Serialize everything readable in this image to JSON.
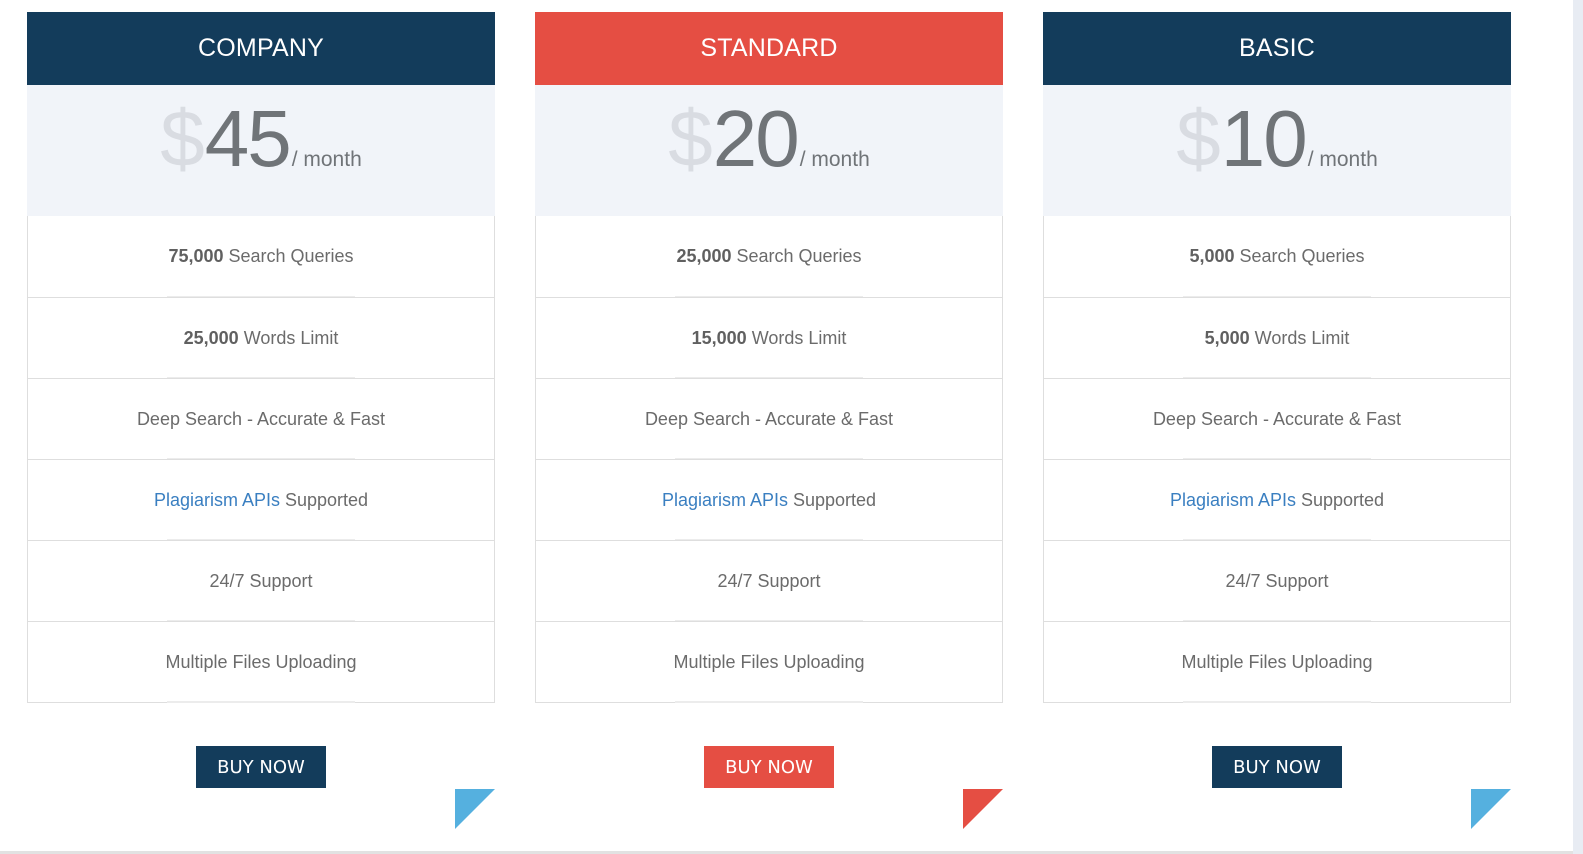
{
  "colors": {
    "navy": "#133c5b",
    "red": "#e54e43",
    "price_bg": "#f1f4f9",
    "link_blue": "#3a7fc1",
    "corner_blue": "#55b0df"
  },
  "plans": [
    {
      "name": "COMPANY",
      "currency": "$",
      "price": "45",
      "period": "/ month",
      "features": [
        {
          "bold": "75,000",
          "text": "Search Queries"
        },
        {
          "bold": "25,000",
          "text": "Words Limit"
        },
        {
          "text": "Deep Search - Accurate & Fast"
        },
        {
          "link": "Plagiarism APIs",
          "text": "Supported"
        },
        {
          "text": "24/7 Support"
        },
        {
          "text": "Multiple Files Uploading"
        }
      ],
      "button_label": "BUY NOW",
      "header_color": "navy",
      "corner_icon": "corner-triangle-blue"
    },
    {
      "name": "STANDARD",
      "currency": "$",
      "price": "20",
      "period": "/ month",
      "features": [
        {
          "bold": "25,000",
          "text": "Search Queries"
        },
        {
          "bold": "15,000",
          "text": "Words Limit"
        },
        {
          "text": "Deep Search - Accurate & Fast"
        },
        {
          "link": "Plagiarism APIs",
          "text": "Supported"
        },
        {
          "text": "24/7 Support"
        },
        {
          "text": "Multiple Files Uploading"
        }
      ],
      "button_label": "BUY NOW",
      "header_color": "red",
      "corner_icon": "corner-triangle-red"
    },
    {
      "name": "BASIC",
      "currency": "$",
      "price": "10",
      "period": "/ month",
      "features": [
        {
          "bold": "5,000",
          "text": "Search Queries"
        },
        {
          "bold": "5,000",
          "text": "Words Limit"
        },
        {
          "text": "Deep Search - Accurate & Fast"
        },
        {
          "link": "Plagiarism APIs",
          "text": "Supported"
        },
        {
          "text": "24/7 Support"
        },
        {
          "text": "Multiple Files Uploading"
        }
      ],
      "button_label": "BUY NOW",
      "header_color": "navy",
      "corner_icon": "corner-triangle-blue"
    }
  ]
}
